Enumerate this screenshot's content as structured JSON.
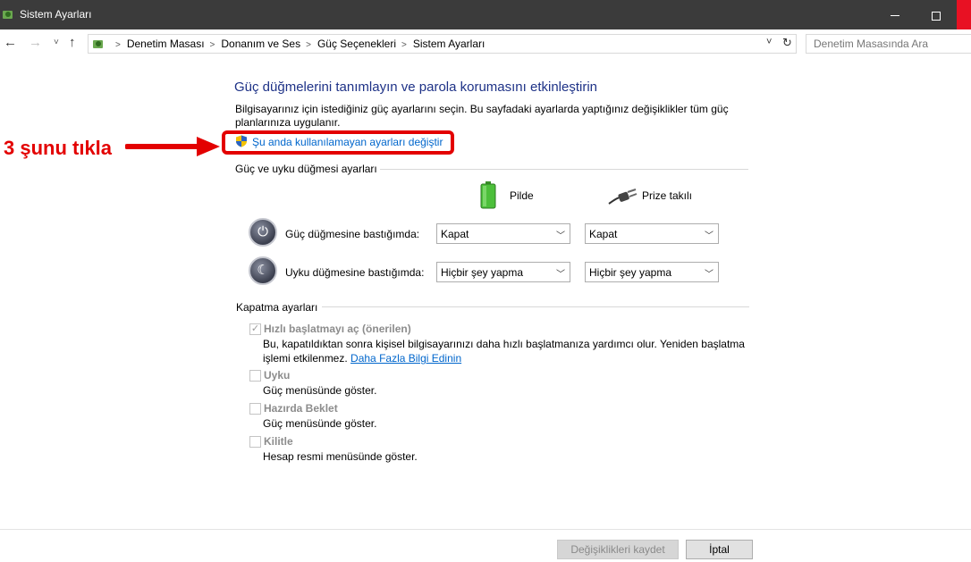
{
  "window": {
    "title": "Sistem Ayarları",
    "minimize": "—",
    "maximize": "☐",
    "close": "✕"
  },
  "nav": {
    "back": "←",
    "forward": "→",
    "recent": "˅",
    "up": "↑",
    "breadcrumbs": [
      "Denetim Masası",
      "Donanım ve Ses",
      "Güç Seçenekleri",
      "Sistem Ayarları"
    ],
    "dropdown": "˅",
    "refresh": "↻",
    "search_placeholder": "Denetim Masasında Ara"
  },
  "content": {
    "heading": "Güç düğmelerini tanımlayın ve parola korumasını etkinleştirin",
    "description": "Bilgisayarınız için istediğiniz güç ayarlarını seçin. Bu sayfadaki ayarlarda yaptığınız değişiklikler tüm güç planlarınıza uygulanır.",
    "change_settings_link": "Şu anda kullanılamayan ayarları değiştir"
  },
  "annotation": {
    "text": "3 şunu tıkla",
    "color": "#e30000"
  },
  "power_section": {
    "title": "Güç ve uyku düğmesi ayarları",
    "col_battery": "Pilde",
    "col_plugged": "Prize takılı",
    "rows": [
      {
        "label": "Güç düğmesine bastığımda:",
        "battery": "Kapat",
        "plugged": "Kapat"
      },
      {
        "label": "Uyku düğmesine bastığımda:",
        "battery": "Hiçbir şey yapma",
        "plugged": "Hiçbir şey yapma"
      }
    ]
  },
  "shutdown_section": {
    "title": "Kapatma ayarları",
    "options": [
      {
        "title": "Hızlı başlatmayı aç (önerilen)",
        "checked": true,
        "desc_line1": "Bu, kapatıldıktan sonra kişisel bilgisayarınızı daha hızlı başlatmanıza yardımcı olur. Yeniden başlatma",
        "desc_line2": "işlemi etkilenmez.",
        "link": "Daha Fazla Bilgi Edinin"
      },
      {
        "title": "Uyku",
        "checked": false,
        "desc": "Güç menüsünde göster."
      },
      {
        "title": "Hazırda Beklet",
        "checked": false,
        "desc": "Güç menüsünde göster."
      },
      {
        "title": "Kilitle",
        "checked": false,
        "desc": "Hesap resmi menüsünde göster."
      }
    ]
  },
  "footer": {
    "save": "Değişiklikleri kaydet",
    "cancel": "İptal"
  }
}
